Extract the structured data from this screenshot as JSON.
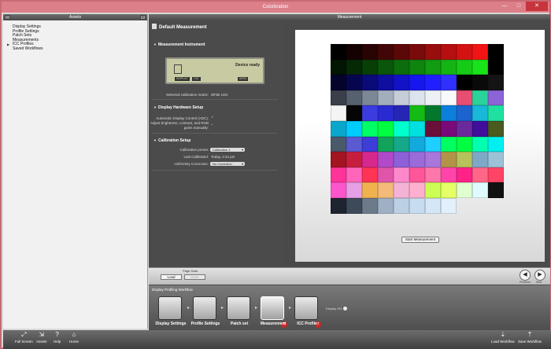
{
  "window": {
    "title": "Colorbration",
    "controls": {
      "minimize": "—",
      "maximize": "□",
      "close": "✕"
    }
  },
  "sidebar": {
    "header": "Assets",
    "items": [
      {
        "label": "Display Settings"
      },
      {
        "label": "Profile Settings"
      },
      {
        "label": "Patch Sets"
      },
      {
        "label": "Measurements"
      },
      {
        "label": "ICC Profiles",
        "expandable": true
      },
      {
        "label": "Saved Workflows"
      }
    ]
  },
  "main": {
    "header": "Measurement",
    "doc_title": "Default Measurement",
    "instrument": {
      "section": "Measurement Instrument",
      "lcd_status": "Device ready",
      "lcd_tags": [
        "DISPLAY",
        "CAL",
        "ABSA"
      ],
      "matrix_label": "Selected calibration matrix:",
      "matrix_value": "White LED"
    },
    "hardware": {
      "section": "Display Hardware Setup",
      "auto_label": "Automatic Display Control (ADC):",
      "auto_value": "✓",
      "adjust_label": "Adjust brightness, contrast, and RGB",
      "adjust_label2": "gains manually:",
      "adjust_value": "–"
    },
    "calibration": {
      "section": "Calibration Setup",
      "preset_label": "Calibration preset:",
      "preset_value": "Calibration 1",
      "last_label": "Last Calibrated:",
      "last_value": "Today, 2:34 pm",
      "uniformity_label": "Uniformity Correction:",
      "uniformity_value": "No Correction"
    },
    "start_button": "Start Measurement"
  },
  "patches": [
    [
      "#000000",
      "#140202",
      "#2a0404",
      "#430606",
      "#5d0808",
      "#7a0b0b",
      "#990d0d",
      "#b60f0f",
      "#d41212",
      "#f21414",
      "#000000"
    ],
    [
      "#031503",
      "#052905",
      "#073f07",
      "#0a560a",
      "#0c6d0c",
      "#0f850f",
      "#119c11",
      "#14b414",
      "#16cb16",
      "#18e318",
      "#000000"
    ],
    [
      "#03032b",
      "#060650",
      "#0a0a78",
      "#0e0ea0",
      "#1212c7",
      "#1616ef",
      "#2020ff",
      "#3030ff",
      "#000000",
      "#0a0a0a",
      "#141414"
    ],
    [
      "#3a3f4a",
      "#57606e",
      "#7c8797",
      "#a3aebc",
      "#c4cdd8",
      "#dce3ec",
      "#edf1f6",
      "#f7f9fb",
      "#e94d72",
      "#2ad39a",
      "#8c64d8"
    ],
    [
      "#f4f4f4",
      "#050505",
      "#3b3be0",
      "#2a2ad2",
      "#2626b4",
      "#14bb14",
      "#02772d",
      "#0c7fdd",
      "#1c63cf",
      "#17b8d8",
      "#1fe0a0"
    ],
    [
      "#0aa7cc",
      "#00ccff",
      "#00ff66",
      "#00ff40",
      "#00ffcc",
      "#00e0e0",
      "#6b0f3a",
      "#7a0a7a",
      "#6b2a9c",
      "#400e9a",
      "#4b5a1e"
    ],
    [
      "#4a5a6a",
      "#5a5ad2",
      "#3d3dd8",
      "#12a35a",
      "#15a88a",
      "#12aadd",
      "#1ecfff",
      "#00ff60",
      "#00ff40",
      "#00ffb0",
      "#00f0f0"
    ],
    [
      "#a31522",
      "#c81e3e",
      "#d7288e",
      "#b04ac8",
      "#8d5fd8",
      "#9a6bd9",
      "#a976dc",
      "#b29448",
      "#b6c25a",
      "#7fa8c8",
      "#9cc2d8"
    ],
    [
      "#ff3399",
      "#ff66bb",
      "#ff3355",
      "#e055aa",
      "#ff88cc",
      "#ff5599",
      "#ff77aa",
      "#ff44aa",
      "#ff2288",
      "#ff6688",
      "#ff4466"
    ],
    [
      "#ff55cc",
      "#e6a0e6",
      "#f0b24e",
      "#f3ba7a",
      "#f4b3d6",
      "#ffb0ce",
      "#ccff55",
      "#e5ff66",
      "#e0ffd0",
      "#e0fbff",
      "#111111"
    ],
    [
      "#1e2430",
      "#3c4a5a",
      "#6c7a8a",
      "#9fb0c4",
      "#bcd0e4",
      "#c8dcef",
      "#d5e7f7",
      "#e2f0fb",
      "",
      "",
      ""
    ]
  ],
  "pagebar": {
    "label": "Page Data",
    "load": "Load",
    "save": "Save",
    "previous": "Previous",
    "next": "Next"
  },
  "workflow": {
    "title": "Display Profiling Workflow",
    "steps": [
      {
        "label": "Display Settings"
      },
      {
        "label": "Profile Settings"
      },
      {
        "label": "Patch set"
      },
      {
        "label": "Measurement",
        "badge": "?"
      },
      {
        "label": "ICC Profile",
        "badge": "?"
      }
    ],
    "more_label": "Display GN"
  },
  "bottombar": {
    "full_screen": "Full Screen",
    "assets": "Assets",
    "help": "Help",
    "home": "Home",
    "load_workflow": "Load Workflow",
    "save_workflow": "Save Workflow"
  }
}
